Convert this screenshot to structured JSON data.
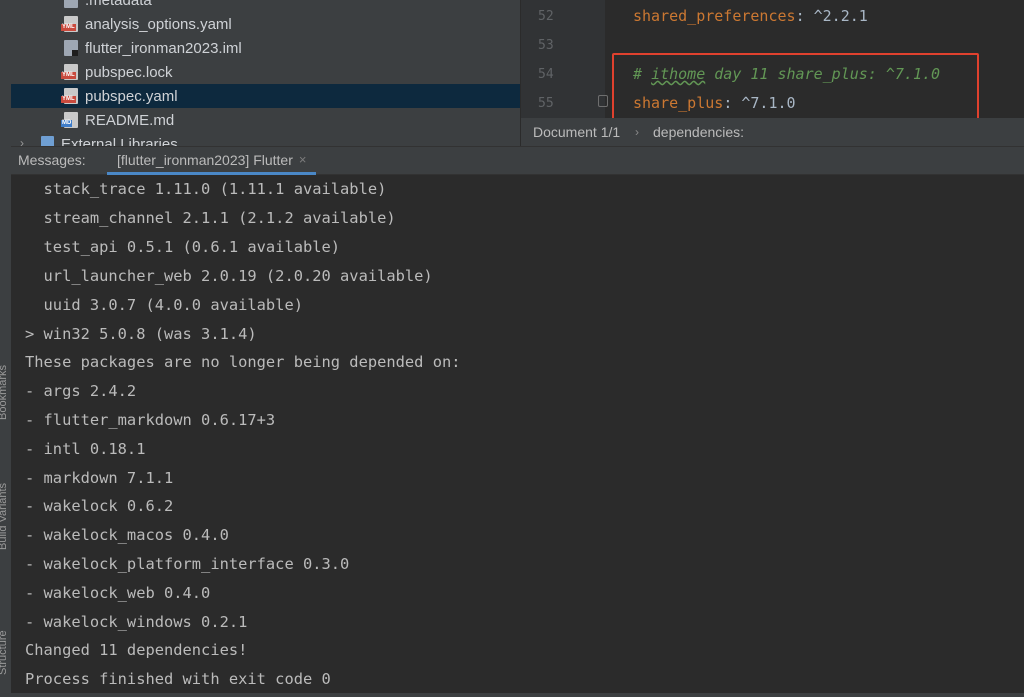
{
  "sidebar_strip": {
    "labels": [
      "Bookmarks",
      "Build Variants",
      "Structure"
    ]
  },
  "project_tree": {
    "items": [
      {
        "label": ".metadata",
        "icon": "file-icon"
      },
      {
        "label": "analysis_options.yaml",
        "icon": "yaml-file-icon"
      },
      {
        "label": "flutter_ironman2023.iml",
        "icon": "iml-file-icon"
      },
      {
        "label": "pubspec.lock",
        "icon": "yaml-file-icon"
      },
      {
        "label": "pubspec.yaml",
        "icon": "yaml-file-icon",
        "selected": true
      },
      {
        "label": "README.md",
        "icon": "markdown-file-icon"
      },
      {
        "label": "External Libraries",
        "icon": "libraries-icon"
      }
    ],
    "icon_tags": {
      "yml": "YML",
      "md": "MD"
    }
  },
  "editor": {
    "lines": [
      {
        "number": "52",
        "key": "shared_preferences",
        "sep": ": ",
        "value": "^2.2.1"
      },
      {
        "number": "53"
      },
      {
        "number": "54",
        "comment_prefix": "# ",
        "comment_word": "ithome",
        "comment_rest": " day 11 share_plus: ^7.1.0"
      },
      {
        "number": "55",
        "key": "share_plus",
        "sep": ": ",
        "value": "^7.1.0"
      }
    ],
    "breadcrumb": {
      "document": "Document 1/1",
      "separator": "›",
      "path": "dependencies:"
    }
  },
  "messages": {
    "title": "Messages:",
    "tab_label": "[flutter_ironman2023] Flutter",
    "tab_close": "×"
  },
  "console": {
    "lines": [
      "  stack_trace 1.11.0 (1.11.1 available)",
      "  stream_channel 2.1.1 (2.1.2 available)",
      "  test_api 0.5.1 (0.6.1 available)",
      "  url_launcher_web 2.0.19 (2.0.20 available)",
      "  uuid 3.0.7 (4.0.0 available)",
      "> win32 5.0.8 (was 3.1.4)",
      "These packages are no longer being depended on:",
      "- args 2.4.2",
      "- flutter_markdown 0.6.17+3",
      "- intl 0.18.1",
      "- markdown 7.1.1",
      "- wakelock 0.6.2",
      "- wakelock_macos 0.4.0",
      "- wakelock_platform_interface 0.3.0",
      "- wakelock_web 0.4.0",
      "- wakelock_windows 0.2.1",
      "Changed 11 dependencies!",
      "Process finished with exit code 0"
    ]
  },
  "colors": {
    "highlight_box": "#e0412e",
    "selected_row": "#0d293e",
    "yaml_key": "#cc7832",
    "comment": "#629755"
  }
}
